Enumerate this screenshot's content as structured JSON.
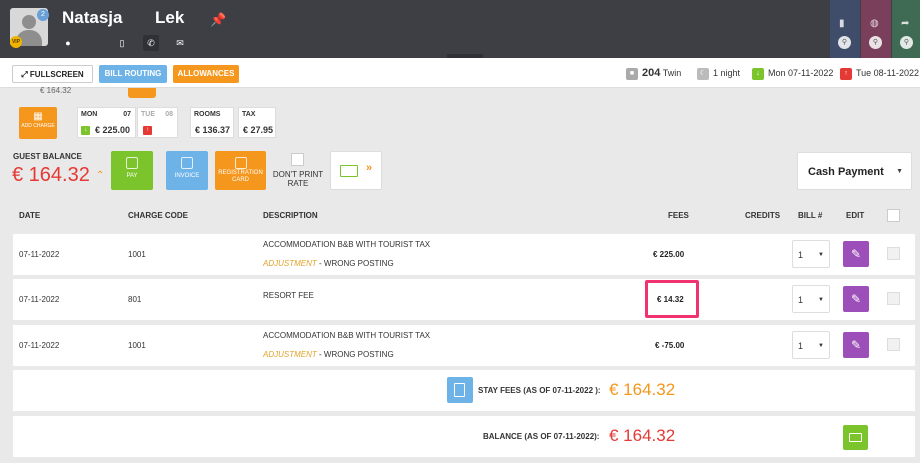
{
  "guest": {
    "first_name": "Natasja",
    "last_name": "Lek",
    "vip_badge": "VIP",
    "notification_count": "2"
  },
  "toolbar": {
    "fullscreen": "FULLSCREEN",
    "bill_routing": "BILL ROUTING",
    "allowances": "ALLOWANCES"
  },
  "reservation": {
    "room": "204",
    "room_type": "Twin",
    "nights": "1 night",
    "arrival": "Mon 07-11-2022",
    "departure": "Tue 08-11-2022"
  },
  "summary": {
    "clipped_amount": "€ 164.32",
    "add_charge": "ADD CHARGE",
    "days": [
      {
        "day": "MON",
        "date": "07",
        "value": "€ 225.00"
      },
      {
        "day": "TUE",
        "date": "08",
        "value": ""
      }
    ],
    "rooms_label": "ROOMS",
    "rooms_value": "€ 136.37",
    "tax_label": "TAX",
    "tax_value": "€ 27.95"
  },
  "balance": {
    "label": "GUEST BALANCE",
    "amount": "€ 164.32",
    "pay": "PAY",
    "invoice": "INVOICE",
    "registration_card": "REGISTRATION CARD",
    "dont_print_rate": "DON'T PRINT RATE",
    "payment_method": "Cash Payment"
  },
  "table": {
    "headers": {
      "date": "DATE",
      "charge_code": "CHARGE CODE",
      "description": "DESCRIPTION",
      "fees": "FEES",
      "credits": "CREDITS",
      "bill": "BILL #",
      "edit": "EDIT"
    },
    "rows": [
      {
        "date": "07-11-2022",
        "code": "1001",
        "description": "ACCOMMODATION B&B WITH TOURIST TAX",
        "adjustment": "ADJUSTMENT",
        "reason": " - WRONG POSTING",
        "fee": "€ 225.00",
        "bill": "1"
      },
      {
        "date": "07-11-2022",
        "code": "801",
        "description": "RESORT FEE",
        "fee": "€ 14.32",
        "bill": "1"
      },
      {
        "date": "07-11-2022",
        "code": "1001",
        "description": "ACCOMMODATION B&B WITH TOURIST TAX",
        "adjustment": "ADJUSTMENT",
        "reason": " - WRONG POSTING",
        "fee": "€ -75.00",
        "bill": "1"
      }
    ]
  },
  "totals": {
    "stay_fees_label": "STAY FEES (AS OF  07-11-2022 ):",
    "stay_fees": "€ 164.32",
    "balance_label": "BALANCE (AS OF  07-11-2022):",
    "balance": "€ 164.32"
  },
  "colors": {
    "header_bg": "#3d3f45",
    "accent_orange": "#f5961d",
    "accent_blue": "#6db3e8",
    "accent_green": "#7cc42c",
    "edit_purple": "#9c4fb8",
    "balance_red": "#e53935",
    "highlight_pink": "#f0336e"
  }
}
